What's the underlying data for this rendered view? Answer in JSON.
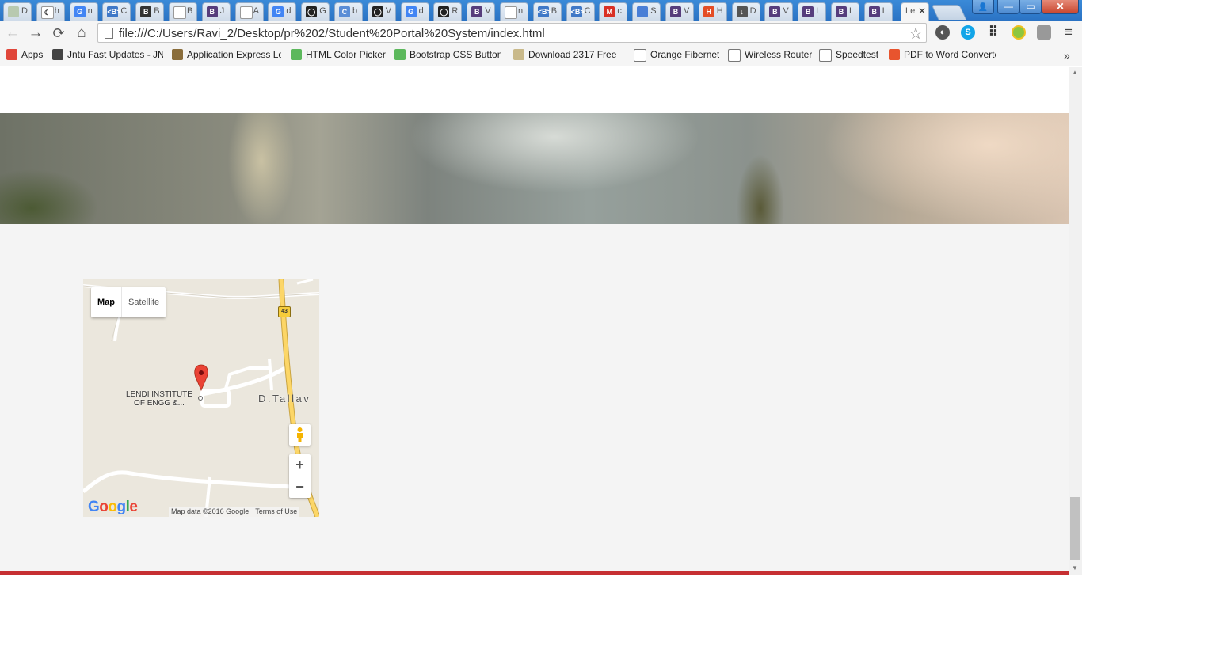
{
  "tabs": [
    {
      "fav": "",
      "color": "#b8c9b0",
      "label": "D"
    },
    {
      "fav": "☾",
      "color": "#ffffff",
      "label": "h"
    },
    {
      "fav": "G",
      "color": "#4285f4",
      "label": "n"
    },
    {
      "fav": "<B>",
      "color": "#3f78c7",
      "label": "C"
    },
    {
      "fav": "B",
      "color": "#333333",
      "label": "B"
    },
    {
      "fav": "",
      "color": "#ffffff",
      "label": "B"
    },
    {
      "fav": "B",
      "color": "#563d7c",
      "label": "J"
    },
    {
      "fav": "",
      "color": "#ffffff",
      "label": "A"
    },
    {
      "fav": "G",
      "color": "#4285f4",
      "label": "d"
    },
    {
      "fav": "◯",
      "color": "#222222",
      "label": "G"
    },
    {
      "fav": "C",
      "color": "#5a8dd6",
      "label": "b"
    },
    {
      "fav": "◯",
      "color": "#222222",
      "label": "V"
    },
    {
      "fav": "G",
      "color": "#4285f4",
      "label": "d"
    },
    {
      "fav": "◯",
      "color": "#222222",
      "label": "R"
    },
    {
      "fav": "B",
      "color": "#563d7c",
      "label": "V"
    },
    {
      "fav": "",
      "color": "#ffffff",
      "label": "n"
    },
    {
      "fav": "<B>",
      "color": "#3f78c7",
      "label": "B"
    },
    {
      "fav": "<B>",
      "color": "#3f78c7",
      "label": "C"
    },
    {
      "fav": "M",
      "color": "#d93025",
      "label": "c"
    },
    {
      "fav": "",
      "color": "#4a7fd6",
      "label": "S"
    },
    {
      "fav": "B",
      "color": "#563d7c",
      "label": "V"
    },
    {
      "fav": "H",
      "color": "#e44d26",
      "label": "H"
    },
    {
      "fav": "↓",
      "color": "#555555",
      "label": "D"
    },
    {
      "fav": "B",
      "color": "#563d7c",
      "label": "V"
    },
    {
      "fav": "B",
      "color": "#563d7c",
      "label": "L"
    },
    {
      "fav": "B",
      "color": "#563d7c",
      "label": "L"
    },
    {
      "fav": "B",
      "color": "#563d7c",
      "label": "L"
    }
  ],
  "active_tab": {
    "label": "Le"
  },
  "window": {
    "close": "✕",
    "minimize": "—",
    "maximize": "▭",
    "user": "👤"
  },
  "toolbar": {
    "back": "←",
    "forward": "→",
    "reload": "⟳",
    "home": "⌂",
    "url": "file:///C:/Users/Ravi_2/Desktop/pr%202/Student%20Portal%20System/index.html",
    "star": "☆",
    "menu": "≡",
    "apps_grid": "⠿"
  },
  "extensions": {
    "skype": "S",
    "shield": "◐",
    "green": "",
    "box": ""
  },
  "bookmarks": [
    {
      "label": "Apps",
      "icon": "apps-grid-icon",
      "color": "#e0463a"
    },
    {
      "label": "Jntu Fast Updates - JN",
      "icon": "graduation-cap-icon",
      "color": "#444444"
    },
    {
      "label": "Application Express Lo",
      "icon": "image-icon",
      "color": "#8a6d3b"
    },
    {
      "label": "HTML Color Picker",
      "icon": "w3-icon",
      "color": "#5cb85c"
    },
    {
      "label": "Bootstrap CSS Button",
      "icon": "w3-icon",
      "color": "#5cb85c"
    },
    {
      "label": "Download 2317 Free I",
      "icon": "folder-icon",
      "color": "#c9b98a"
    },
    {
      "label": "Orange Fibernet",
      "icon": "moon-icon",
      "color": "#ffffff"
    },
    {
      "label": "Wireless Router",
      "icon": "page-icon",
      "color": "#ffffff"
    },
    {
      "label": "Speedtest",
      "icon": "gauge-icon",
      "color": "#ffffff"
    },
    {
      "label": "PDF to Word Converte",
      "icon": "pdf-icon",
      "color": "#e8542e"
    }
  ],
  "bookmarks_more": "»",
  "page": {
    "footer_color": "#c62f32"
  },
  "map": {
    "type_map": "Map",
    "type_satellite": "Satellite",
    "place_label": "LENDI INSTITUTE OF ENGG &...",
    "town_label": "D.Tallav",
    "route_number": "43",
    "zoom_in": "+",
    "zoom_out": "−",
    "google": [
      "G",
      "o",
      "o",
      "g",
      "l",
      "e"
    ],
    "attribution": "Map data ©2016 Google",
    "terms": "Terms of Use"
  },
  "scrollbar": {
    "up": "▲",
    "down": "▼"
  }
}
